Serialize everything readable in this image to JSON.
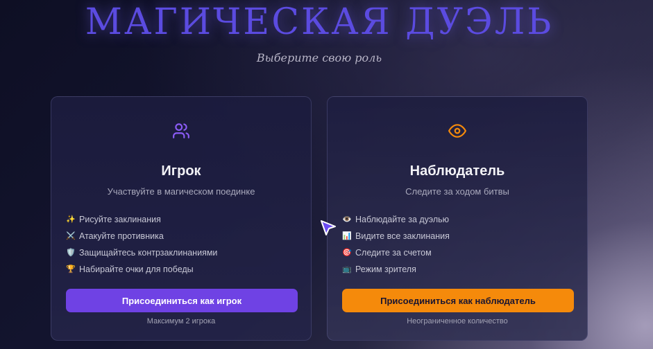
{
  "header": {
    "title": "МАГИЧЕСКАЯ ДУЭЛЬ",
    "subtitle": "Выберите свою роль"
  },
  "colors": {
    "accent_purple": "#6f42e4",
    "accent_orange": "#f58a0b",
    "title_color": "#5b4be0"
  },
  "cards": [
    {
      "icon": "users-icon",
      "title": "Игрок",
      "description": "Участвуйте в магическом поединке",
      "features": [
        {
          "emoji": "✨",
          "text": "Рисуйте заклинания"
        },
        {
          "emoji": "⚔️",
          "text": "Атакуйте противника"
        },
        {
          "emoji": "🛡️",
          "text": "Защищайтесь контрзаклинаниями"
        },
        {
          "emoji": "🏆",
          "text": "Набирайте очки для победы"
        }
      ],
      "button_label": "Присоединиться как игрок",
      "note": "Максимум 2 игрока"
    },
    {
      "icon": "eye-icon",
      "title": "Наблюдатель",
      "description": "Следите за ходом битвы",
      "features": [
        {
          "emoji": "👁️",
          "text": "Наблюдайте за дуэлью"
        },
        {
          "emoji": "📊",
          "text": "Видите все заклинания"
        },
        {
          "emoji": "🎯",
          "text": "Следите за счетом"
        },
        {
          "emoji": "📺",
          "text": "Режим зрителя"
        }
      ],
      "button_label": "Присоединиться как наблюдатель",
      "note": "Неограниченное количество"
    }
  ]
}
